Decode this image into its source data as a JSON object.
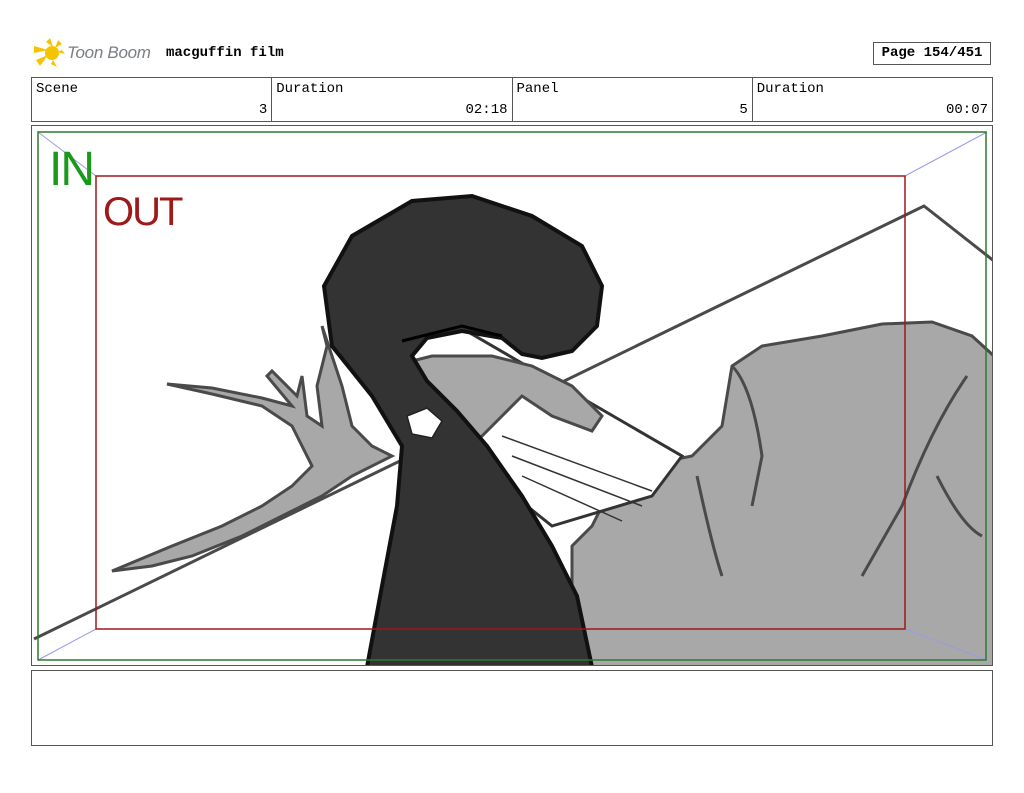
{
  "header": {
    "brand": "Toon Boom",
    "film_title": "macguffin film",
    "page_label": "Page 154/451",
    "logo_icon": "sunburst-logo-icon",
    "brand_color": "#f5c400"
  },
  "info": [
    {
      "label": "Scene",
      "value": "3"
    },
    {
      "label": "Duration",
      "value": "02:18"
    },
    {
      "label": "Panel",
      "value": "5"
    },
    {
      "label": "Duration",
      "value": "00:07"
    }
  ],
  "frame": {
    "in_label": "IN",
    "out_label": "OUT",
    "in_color": "#1a9a1a",
    "out_color": "#a01818"
  },
  "notes": {
    "text": ""
  }
}
